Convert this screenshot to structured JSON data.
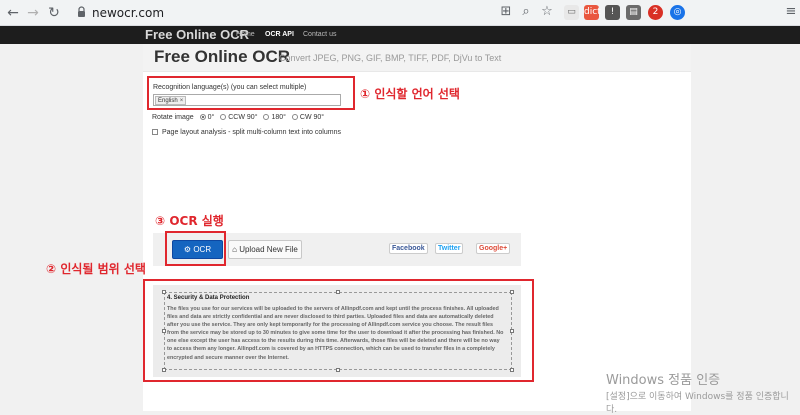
{
  "browser": {
    "url": "newocr.com",
    "back_icon": "arrow-left-icon",
    "forward_icon": "arrow-right-icon",
    "reload_icon": "reload-icon",
    "lock_icon": "lock-icon",
    "ext_badge_count": "2",
    "ext_label_red": "dict"
  },
  "site_nav": {
    "brand": "Free Online OCR",
    "links": [
      "Home",
      "OCR API",
      "Contact us"
    ],
    "active_index": 1
  },
  "page": {
    "title": "Free Online OCR",
    "subtitle": "Convert JPEG, PNG, GIF, BMP, TIFF, PDF, DjVu to Text"
  },
  "form": {
    "language_label": "Recognition language(s) (you can select multiple)",
    "language_tag": "English",
    "language_tag_remove": "×",
    "rotate_label": "Rotate image",
    "rotate_options": [
      "0°",
      "CCW 90°",
      "180°",
      "CW 90°"
    ],
    "rotate_selected_index": 0,
    "layout_checkbox_label": "Page layout analysis - split multi-column text into columns"
  },
  "actions": {
    "ocr_button": "OCR",
    "ocr_icon": "gear-icon",
    "upload_button": "Upload New File",
    "upload_icon": "home-icon",
    "facebook": "Facebook",
    "twitter": "Twitter",
    "google": "Google+"
  },
  "result": {
    "heading": "4. Security & Data Protection",
    "body": "The files you use for our services will be uploaded to the servers of Allinpdf.com and kept until the process finishes. All uploaded files and data are strictly confidential and are never disclosed to third parties. Uploaded files and data are automatically deleted after you use the service. They are only kept temporarily for the processing of Allinpdf.com service you choose. The result files from the service may be stored up to 30 minutes to give some time for the user to download it after the processing has finished. No one else except the user has access to the results during this time. Afterwards, those files will be deleted and there will be no way to access them any longer. Allinpdf.com is covered by an HTTPS connection, which can be used to transfer files in a completely encrypted and secure manner over the Internet."
  },
  "annotations": {
    "step1": "① 인식할 언어 선택",
    "step2": "② 인식될 범위 선택",
    "step3": "③ OCR 실행",
    "accent_color": "#e0272e"
  },
  "watermark": {
    "line1": "Windows 정품 인증",
    "line2": "[설정]으로 이동하여 Windows를 정품 인증합니",
    "line3": "다."
  }
}
